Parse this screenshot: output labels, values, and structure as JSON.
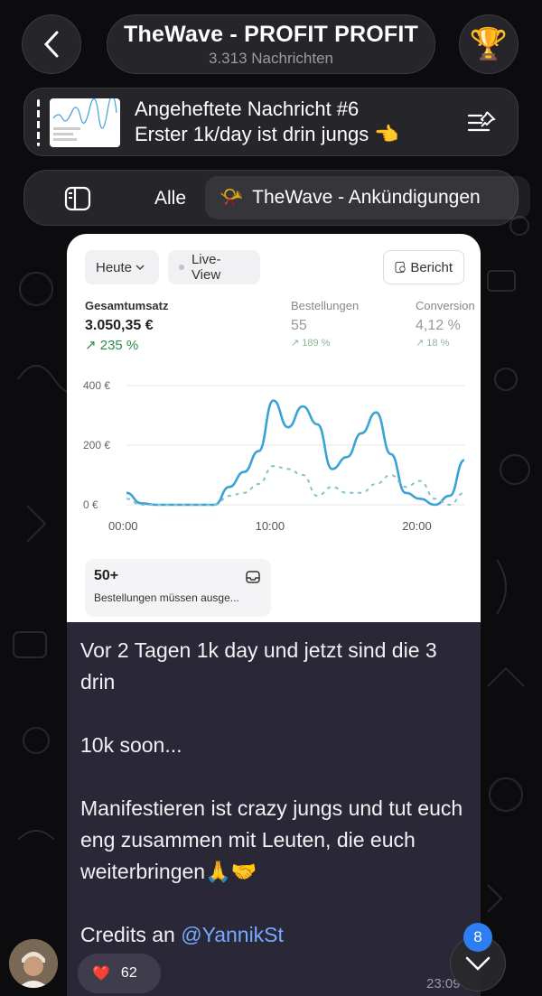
{
  "header": {
    "title": "TheWave - PROFIT PROFIT",
    "subtitle": "3.313 Nachrichten"
  },
  "pinned": {
    "title": "Angeheftete Nachricht #6",
    "text": "Erster 1k/day ist drin jungs 👈"
  },
  "filters": {
    "all_label": "Alle",
    "active_label": "TheWave - Ankündigungen",
    "active_emoji": "📯"
  },
  "dashboard": {
    "date_button": "Heute",
    "live_button": "Live-View",
    "report_button": "Bericht",
    "kpis": [
      {
        "label": "Gesamtumsatz",
        "value": "3.050,35 €",
        "change": "↗ 235 %"
      },
      {
        "label": "Bestellungen",
        "value": "55",
        "change": "↗ 189 %"
      },
      {
        "label": "Conversion",
        "value": "4,12 %",
        "change": "↗ 18 %"
      }
    ],
    "orders_card": {
      "value": "50+",
      "label": "Bestellungen müssen ausge..."
    }
  },
  "chart_data": {
    "type": "line",
    "x_ticks": [
      "00:00",
      "10:00",
      "20:00"
    ],
    "y_ticks": [
      "0 €",
      "200 €",
      "400 €"
    ],
    "ylim": [
      0,
      400
    ],
    "x": [
      0,
      1,
      2,
      3,
      4,
      5,
      6,
      7,
      8,
      9,
      10,
      11,
      12,
      13,
      14,
      15,
      16,
      17,
      18,
      19,
      20,
      21,
      22,
      23
    ],
    "series": [
      {
        "values": [
          40,
          5,
          0,
          0,
          0,
          0,
          0,
          60,
          110,
          180,
          350,
          260,
          330,
          270,
          120,
          160,
          240,
          310,
          170,
          40,
          20,
          0,
          30,
          150
        ]
      },
      {
        "values": [
          20,
          0,
          0,
          0,
          0,
          0,
          0,
          30,
          40,
          70,
          130,
          120,
          100,
          30,
          60,
          40,
          40,
          70,
          100,
          60,
          80,
          20,
          0,
          40
        ]
      }
    ],
    "colors": {
      "primary": "#3aa2d6",
      "secondary": "#7fc2c8"
    }
  },
  "message": {
    "paragraphs": [
      "Vor 2 Tagen 1k day und jetzt sind die 3 drin",
      "10k soon...",
      "Manifestieren ist crazy jungs und tut euch eng zusammen mit Leuten, die euch weiterbringen🙏🤝"
    ],
    "credits_prefix": "Credits an ",
    "mention": "@YannikSt",
    "time": "23:09"
  },
  "reaction": {
    "emoji": "❤️",
    "count": "62"
  },
  "scroll": {
    "badge": "8"
  }
}
